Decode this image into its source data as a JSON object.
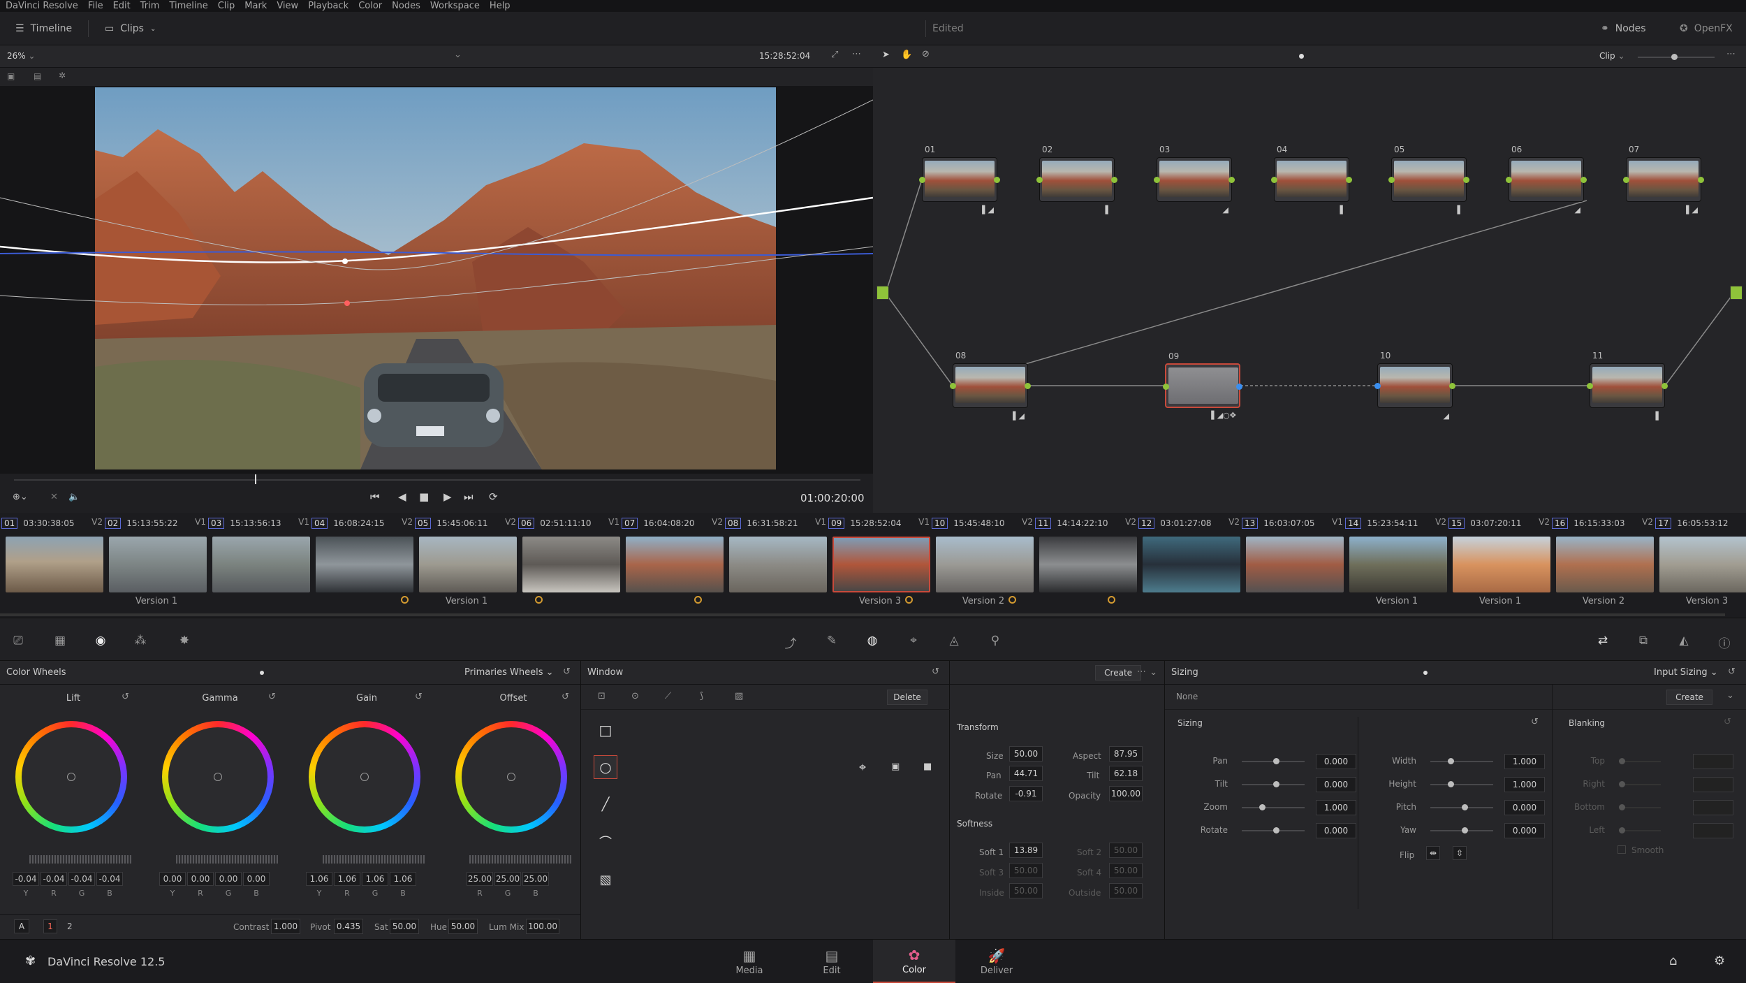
{
  "menu": [
    "DaVinci Resolve",
    "File",
    "Edit",
    "Trim",
    "Timeline",
    "Clip",
    "Mark",
    "View",
    "Playback",
    "Color",
    "Nodes",
    "Workspace",
    "Help"
  ],
  "topbar": {
    "timeline_label": "Timeline",
    "clips_label": "Clips",
    "project_status": "Edited",
    "nodes_label": "Nodes",
    "openfx_label": "OpenFX"
  },
  "viewer": {
    "zoom": "26%",
    "source_timecode": "15:28:52:04",
    "record_timecode": "01:00:20:00"
  },
  "nodebar": {
    "mode": "Clip"
  },
  "nodes": [
    {
      "num": "01",
      "icons": "▌◢"
    },
    {
      "num": "02",
      "icons": "▌"
    },
    {
      "num": "03",
      "icons": "◢"
    },
    {
      "num": "04",
      "icons": "▌"
    },
    {
      "num": "05",
      "icons": "▌"
    },
    {
      "num": "06",
      "icons": "◢"
    },
    {
      "num": "07",
      "icons": "▌◢"
    },
    {
      "num": "08",
      "icons": "▌◢"
    },
    {
      "num": "09",
      "icons": "▌◢○✥"
    },
    {
      "num": "10",
      "icons": "◢"
    },
    {
      "num": "11",
      "icons": "▌"
    }
  ],
  "clips": [
    {
      "num": "01",
      "tc": "03:30:38:05",
      "track": "V2",
      "version": ""
    },
    {
      "num": "02",
      "tc": "15:13:55:22",
      "track": "V1",
      "version": "Version 1"
    },
    {
      "num": "03",
      "tc": "15:13:56:13",
      "track": "V1",
      "version": ""
    },
    {
      "num": "04",
      "tc": "16:08:24:15",
      "track": "V2",
      "version": ""
    },
    {
      "num": "05",
      "tc": "15:45:06:11",
      "track": "V2",
      "version": "Version 1"
    },
    {
      "num": "06",
      "tc": "02:51:11:10",
      "track": "V1",
      "version": ""
    },
    {
      "num": "07",
      "tc": "16:04:08:20",
      "track": "V2",
      "version": ""
    },
    {
      "num": "08",
      "tc": "16:31:58:21",
      "track": "V1",
      "version": ""
    },
    {
      "num": "09",
      "tc": "15:28:52:04",
      "track": "V1",
      "version": "Version 3"
    },
    {
      "num": "10",
      "tc": "15:45:48:10",
      "track": "V2",
      "version": "Version 2"
    },
    {
      "num": "11",
      "tc": "14:14:22:10",
      "track": "V2",
      "version": ""
    },
    {
      "num": "12",
      "tc": "03:01:27:08",
      "track": "V2",
      "version": ""
    },
    {
      "num": "13",
      "tc": "16:03:07:05",
      "track": "V1",
      "version": ""
    },
    {
      "num": "14",
      "tc": "15:23:54:11",
      "track": "V2",
      "version": "Version 1"
    },
    {
      "num": "15",
      "tc": "03:07:20:11",
      "track": "V2",
      "version": "Version 1"
    },
    {
      "num": "16",
      "tc": "16:15:33:03",
      "track": "V2",
      "version": "Version 2"
    },
    {
      "num": "17",
      "tc": "16:05:53:12",
      "track": "",
      "version": "Version 3"
    }
  ],
  "color_wheels": {
    "title": "Color Wheels",
    "mode": "Primaries Wheels",
    "wheels": [
      {
        "name": "Lift",
        "values": [
          "-0.04",
          "-0.04",
          "-0.04",
          "-0.04"
        ],
        "labels": [
          "Y",
          "R",
          "G",
          "B"
        ]
      },
      {
        "name": "Gamma",
        "values": [
          "0.00",
          "0.00",
          "0.00",
          "0.00"
        ],
        "labels": [
          "Y",
          "R",
          "G",
          "B"
        ]
      },
      {
        "name": "Gain",
        "values": [
          "1.06",
          "1.06",
          "1.06",
          "1.06"
        ],
        "labels": [
          "Y",
          "R",
          "G",
          "B"
        ]
      },
      {
        "name": "Offset",
        "values": [
          "25.00",
          "25.00",
          "25.00"
        ],
        "labels": [
          "R",
          "G",
          "B"
        ]
      }
    ],
    "footer": {
      "a_label": "A",
      "page1": "1",
      "page2": "2",
      "contrast_label": "Contrast",
      "contrast": "1.000",
      "pivot_label": "Pivot",
      "pivot": "0.435",
      "sat_label": "Sat",
      "sat": "50.00",
      "hue_label": "Hue",
      "hue": "50.00",
      "lummix_label": "Lum Mix",
      "lummix": "100.00"
    }
  },
  "window": {
    "title": "Window",
    "delete_label": "Delete",
    "create_label": "Create",
    "transform_title": "Transform",
    "size_label": "Size",
    "size": "50.00",
    "aspect_label": "Aspect",
    "aspect": "87.95",
    "pan_label": "Pan",
    "pan": "44.71",
    "tilt_label": "Tilt",
    "tilt": "62.18",
    "rotate_label": "Rotate",
    "rotate": "-0.91",
    "opacity_label": "Opacity",
    "opacity": "100.00",
    "softness_title": "Softness",
    "soft1_label": "Soft 1",
    "soft1": "13.89",
    "soft2_label": "Soft 2",
    "soft2": "50.00",
    "soft3_label": "Soft 3",
    "soft3": "50.00",
    "soft4_label": "Soft 4",
    "soft4": "50.00",
    "inside_label": "Inside",
    "inside": "50.00",
    "outside_label": "Outside",
    "outside": "50.00"
  },
  "sizing": {
    "title": "Sizing",
    "mode": "Input Sizing",
    "preset": "None",
    "create_label": "Create",
    "section": "Sizing",
    "left": [
      {
        "label": "Pan",
        "value": "0.000"
      },
      {
        "label": "Tilt",
        "value": "0.000"
      },
      {
        "label": "Zoom",
        "value": "1.000"
      },
      {
        "label": "Rotate",
        "value": "0.000"
      }
    ],
    "right": [
      {
        "label": "Width",
        "value": "1.000"
      },
      {
        "label": "Height",
        "value": "1.000"
      },
      {
        "label": "Pitch",
        "value": "0.000"
      },
      {
        "label": "Yaw",
        "value": "0.000"
      }
    ],
    "flip_label": "Flip",
    "blanking_title": "Blanking",
    "blanking": [
      "Top",
      "Right",
      "Bottom",
      "Left"
    ],
    "smooth_label": "Smooth"
  },
  "statusbar": {
    "app": "DaVinci Resolve 12.5",
    "pages": [
      "Media",
      "Edit",
      "Color",
      "Deliver"
    ]
  },
  "colors": {
    "accent": "#c94a3b",
    "node_dot": "#8fc33a",
    "clip_num_border": "#5b6ad6",
    "marker": "#d39a30"
  }
}
